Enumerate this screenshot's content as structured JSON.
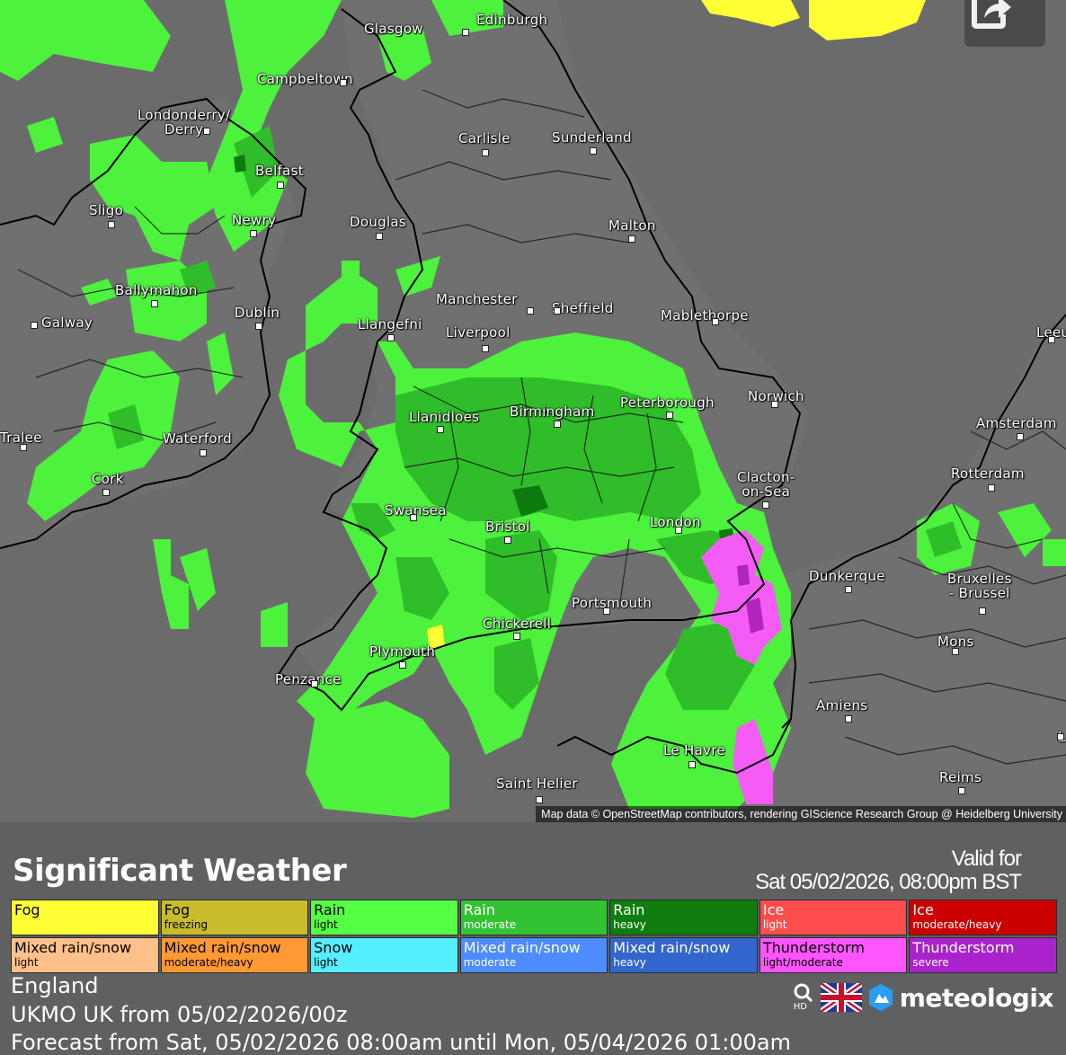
{
  "map": {
    "attribution": "Map data © OpenStreetMap contributors, rendering GIScience Research Group @ Heidelberg University",
    "cities": [
      {
        "name": "Glasgow"
      },
      {
        "name": "Edinburgh"
      },
      {
        "name": "Campbeltown"
      },
      {
        "name": "Londonderry/\nDerry"
      },
      {
        "name": "Carlisle"
      },
      {
        "name": "Sunderland"
      },
      {
        "name": "Belfast"
      },
      {
        "name": "Sligo"
      },
      {
        "name": "Newry"
      },
      {
        "name": "Douglas"
      },
      {
        "name": "Malton"
      },
      {
        "name": "Ballymahon"
      },
      {
        "name": "Manchester"
      },
      {
        "name": "Sheffield"
      },
      {
        "name": "Galway"
      },
      {
        "name": "Dublin"
      },
      {
        "name": "Llangefni"
      },
      {
        "name": "Liverpool"
      },
      {
        "name": "Mablethorpe"
      },
      {
        "name": "Leeu"
      },
      {
        "name": "Norwich"
      },
      {
        "name": "Peterborough"
      },
      {
        "name": "Birmingham"
      },
      {
        "name": "Llanidloes"
      },
      {
        "name": "Tralee"
      },
      {
        "name": "Waterford"
      },
      {
        "name": "Amsterdam"
      },
      {
        "name": "Cork"
      },
      {
        "name": "Clacton-\non-Sea"
      },
      {
        "name": "Rotterdam"
      },
      {
        "name": "Swansea"
      },
      {
        "name": "Bristol"
      },
      {
        "name": "London"
      },
      {
        "name": "Dunkerque"
      },
      {
        "name": "Bruxelles\n- Brussel"
      },
      {
        "name": "Portsmouth"
      },
      {
        "name": "Chickerell"
      },
      {
        "name": "Plymouth"
      },
      {
        "name": "Mons"
      },
      {
        "name": "Penzance"
      },
      {
        "name": "Amiens"
      },
      {
        "name": "Le Havre"
      },
      {
        "name": "Reims"
      },
      {
        "name": "Saint Helier"
      },
      {
        "name": "L"
      }
    ]
  },
  "legend": {
    "title": "Significant Weather",
    "valid_line1": "Valid for",
    "valid_line2": "Sat 05/02/2026, 08:00pm BST",
    "categories": [
      {
        "label": "Fog",
        "sub": "",
        "color": "#ffff33"
      },
      {
        "label": "Fog",
        "sub": "freezing",
        "color": "#c8bc2c"
      },
      {
        "label": "Rain",
        "sub": "light",
        "color": "#55ff44"
      },
      {
        "label": "Rain",
        "sub": "moderate",
        "color": "#33c233"
      },
      {
        "label": "Rain",
        "sub": "heavy",
        "color": "#0f7d0f"
      },
      {
        "label": "Ice",
        "sub": "light",
        "color": "#ff4d4d"
      },
      {
        "label": "Ice",
        "sub": "moderate/heavy",
        "color": "#cc0000"
      },
      {
        "label": "Mixed rain/snow",
        "sub": "light",
        "color": "#ffc08a"
      },
      {
        "label": "Mixed rain/snow",
        "sub": "moderate/heavy",
        "color": "#ff9933"
      },
      {
        "label": "Snow",
        "sub": "light",
        "color": "#55eeff"
      },
      {
        "label": "Mixed rain/snow",
        "sub": "moderate",
        "color": "#4d8cff"
      },
      {
        "label": "Mixed rain/snow",
        "sub": "heavy",
        "color": "#3366cc"
      },
      {
        "label": "Thunderstorm",
        "sub": "light/moderate",
        "color": "#ff55ff"
      },
      {
        "label": "Thunderstorm",
        "sub": "severe",
        "color": "#aa22cc"
      }
    ],
    "region": "England",
    "model": "UKMO UK from 05/02/2026/00z",
    "forecast": "Forecast from Sat, 05/02/2026 08:00am until Mon, 05/04/2026 01:00am",
    "hd_label": "HD",
    "brand": "meteologix"
  },
  "icons": {
    "share": "share-icon",
    "search": "search-hd-icon",
    "flag": "uk-flag-icon",
    "logo": "meteologix-logo-icon"
  }
}
